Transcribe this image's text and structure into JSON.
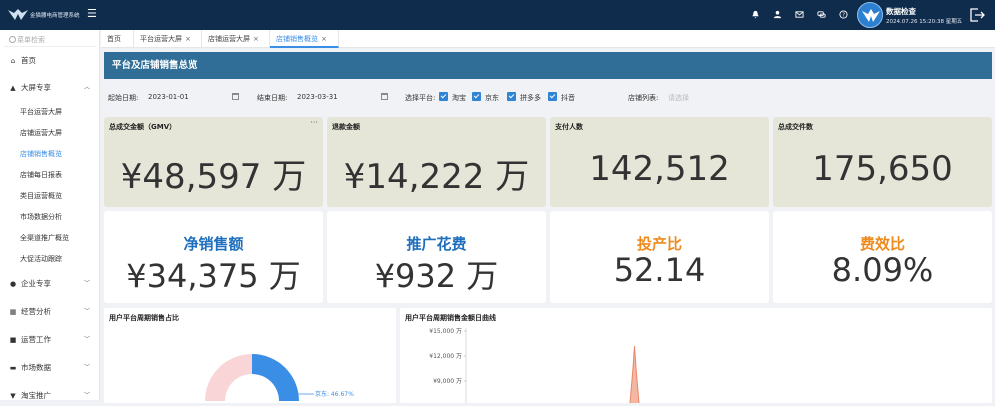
{
  "app": {
    "title": "金猫腰电商管理系统",
    "colors": {
      "topbar": "#0f2c4c",
      "header": "#306e97",
      "accent": "#3a8ee6"
    }
  },
  "topbar": {
    "icons": [
      "bell-icon",
      "user-icon",
      "mail-icon",
      "chat-icon",
      "help-icon"
    ],
    "user_name": "数据检查",
    "datetime": "2024.07.26 15:20:38 星期五"
  },
  "sidebar": {
    "search_placeholder": "菜单检索",
    "items": [
      {
        "label": "首页",
        "icon": "home-icon"
      },
      {
        "label": "大屏专享",
        "icon": "bank-icon",
        "expanded": true,
        "children": [
          "平台运营大屏",
          "店铺运营大屏",
          "店铺销售概览",
          "店铺每日报表",
          "类目运营概览",
          "市场数据分析",
          "全渠道推广概览",
          "大促活动跟踪"
        ],
        "active_child": "店铺销售概览"
      },
      {
        "label": "企业专享",
        "icon": "pin-icon"
      },
      {
        "label": "经营分析",
        "icon": "calendar-icon"
      },
      {
        "label": "运营工作",
        "icon": "briefcase-icon"
      },
      {
        "label": "市场数据",
        "icon": "chart-icon"
      },
      {
        "label": "淘宝推广",
        "icon": "cart-icon"
      }
    ]
  },
  "tabs": [
    {
      "label": "首页",
      "closable": false
    },
    {
      "label": "平台运营大屏",
      "closable": true
    },
    {
      "label": "店铺运营大屏",
      "closable": true
    },
    {
      "label": "店铺销售概览",
      "closable": true,
      "active": true
    }
  ],
  "page": {
    "title": "平台及店铺销售总览"
  },
  "filters": {
    "start_label": "起始日期:",
    "start_value": "2023-01-01",
    "end_label": "结束日期:",
    "end_value": "2023-03-31",
    "platform_label": "选择平台:",
    "platforms": [
      {
        "label": "淘宝",
        "checked": true
      },
      {
        "label": "京东",
        "checked": true
      },
      {
        "label": "拼多多",
        "checked": true
      },
      {
        "label": "抖音",
        "checked": true
      }
    ],
    "shop_label": "店铺列表:",
    "shop_placeholder": "请选择"
  },
  "stats": [
    {
      "title": "总成交金额（GMV）",
      "value": "¥48,597 万",
      "more": "···"
    },
    {
      "title": "退款金额",
      "value": "¥14,222 万"
    },
    {
      "title": "支付人数",
      "value": "142,512"
    },
    {
      "title": "总成交件数",
      "value": "175,650"
    }
  ],
  "kpis": [
    {
      "title": "净销售额",
      "value": "¥34,375 万",
      "color": "#1f6fbd"
    },
    {
      "title": "推广花费",
      "value": "¥932 万",
      "color": "#1f6fbd"
    },
    {
      "title": "投产比",
      "value": "52.14",
      "color": "#ee8a1e"
    },
    {
      "title": "费效比",
      "value": "8.09%",
      "color": "#ee8a1e"
    }
  ],
  "pie_panel": {
    "title": "用户平台周期销售占比",
    "visible_label": "京东: 46.67%",
    "slice_colors": [
      "#3a8ee6",
      "#f9d5d8"
    ]
  },
  "line_panel": {
    "title": "用户平台周期销售金额日曲线",
    "y_ticks": [
      "¥15,000 万",
      "¥12,000 万",
      "¥9,000 万"
    ],
    "line_color": "#e8866b"
  },
  "chart_data": [
    {
      "type": "pie",
      "title": "用户平台周期销售占比",
      "series": [
        {
          "name": "京东",
          "value": 46.67
        }
      ],
      "unit": "%"
    },
    {
      "type": "line",
      "title": "用户平台周期销售金额日曲线",
      "ylim": [
        0,
        15000
      ],
      "y_ticks": [
        15000,
        12000,
        9000
      ],
      "yunit": "万",
      "spike_peak": 12500
    }
  ]
}
